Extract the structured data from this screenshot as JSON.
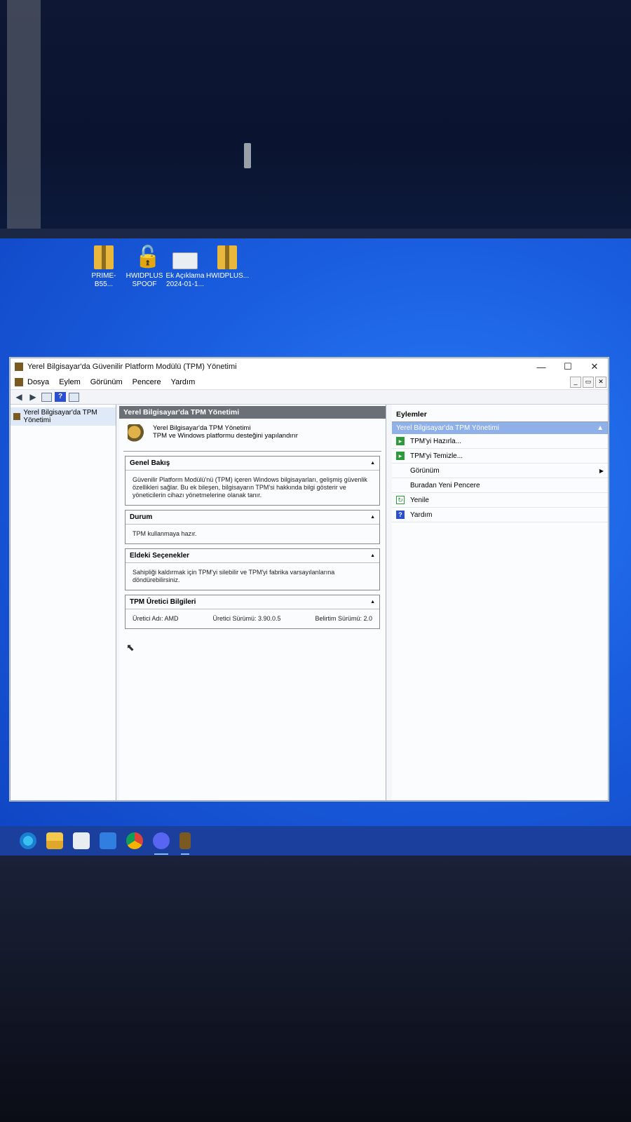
{
  "desktop": {
    "icons": [
      {
        "label": "PRIME-B55..."
      },
      {
        "label": "HWIDPLUS SPOOF"
      },
      {
        "label": "Ek Açıklama 2024-01-1..."
      },
      {
        "label": "HWIDPLUS..."
      }
    ]
  },
  "window": {
    "title": "Yerel Bilgisayar'da Güvenilir Platform Modülü (TPM) Yönetimi",
    "controls": {
      "minimize": "—",
      "maximize": "☐",
      "close": "✕"
    },
    "menu": [
      "Dosya",
      "Eylem",
      "Görünüm",
      "Pencere",
      "Yardım"
    ],
    "mdi_controls": {
      "minimize": "_",
      "restore": "▭",
      "close": "✕"
    }
  },
  "tree": {
    "root": "Yerel Bilgisayar'da TPM Yönetimi"
  },
  "center": {
    "header": "Yerel Bilgisayar'da TPM Yönetimi",
    "intro_line1": "Yerel Bilgisayar'da TPM Yönetimi",
    "intro_line2": "TPM ve Windows platformu desteğini yapılandırır",
    "overview": {
      "title": "Genel Bakış",
      "text": "Güvenilir Platform Modülü'nü (TPM) içeren Windows bilgisayarları, gelişmiş güvenlik özellikleri sağlar. Bu ek bileşen, bilgisayarın TPM'si hakkında bilgi gösterir ve yöneticilerin cihazı yönetmelerine olanak tanır."
    },
    "status": {
      "title": "Durum",
      "text": "TPM kullanmaya hazır."
    },
    "options": {
      "title": "Eldeki Seçenekler",
      "text": "Sahipliği kaldırmak için TPM'yi silebilir ve TPM'yi fabrika varsayılanlarına döndürebilirsiniz."
    },
    "manufacturer": {
      "title": "TPM Üretici Bilgileri",
      "name_label": "Üretici Adı:",
      "name_value": "AMD",
      "version_label": "Üretici Sürümü:",
      "version_value": "3.90.0.5",
      "spec_label": "Belirtim Sürümü:",
      "spec_value": "2.0"
    }
  },
  "actions": {
    "header": "Eylemler",
    "subheader": "Yerel Bilgisayar'da TPM Yönetimi",
    "items": [
      {
        "label": "TPM'yi Hazırla..."
      },
      {
        "label": "TPM'yi Temizle..."
      },
      {
        "label": "Görünüm"
      },
      {
        "label": "Buradan Yeni Pencere"
      },
      {
        "label": "Yenile"
      },
      {
        "label": "Yardım"
      }
    ]
  }
}
